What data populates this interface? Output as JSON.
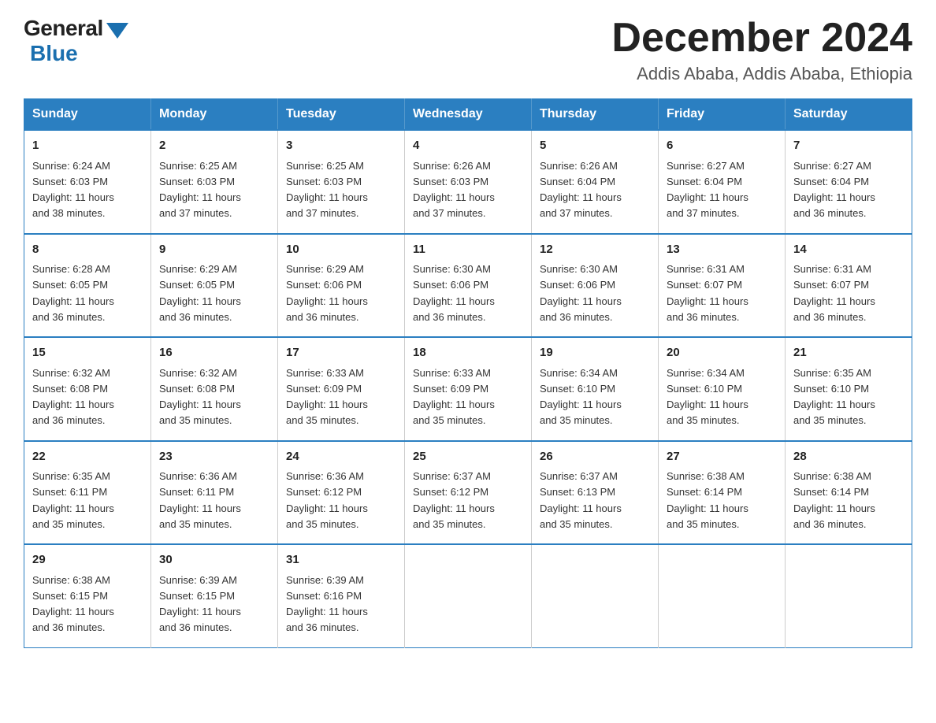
{
  "header": {
    "logo_general": "General",
    "logo_blue": "Blue",
    "month_title": "December 2024",
    "location": "Addis Ababa, Addis Ababa, Ethiopia"
  },
  "weekdays": [
    "Sunday",
    "Monday",
    "Tuesday",
    "Wednesday",
    "Thursday",
    "Friday",
    "Saturday"
  ],
  "weeks": [
    [
      {
        "day": "1",
        "sunrise": "6:24 AM",
        "sunset": "6:03 PM",
        "daylight": "11 hours and 38 minutes."
      },
      {
        "day": "2",
        "sunrise": "6:25 AM",
        "sunset": "6:03 PM",
        "daylight": "11 hours and 37 minutes."
      },
      {
        "day": "3",
        "sunrise": "6:25 AM",
        "sunset": "6:03 PM",
        "daylight": "11 hours and 37 minutes."
      },
      {
        "day": "4",
        "sunrise": "6:26 AM",
        "sunset": "6:03 PM",
        "daylight": "11 hours and 37 minutes."
      },
      {
        "day": "5",
        "sunrise": "6:26 AM",
        "sunset": "6:04 PM",
        "daylight": "11 hours and 37 minutes."
      },
      {
        "day": "6",
        "sunrise": "6:27 AM",
        "sunset": "6:04 PM",
        "daylight": "11 hours and 37 minutes."
      },
      {
        "day": "7",
        "sunrise": "6:27 AM",
        "sunset": "6:04 PM",
        "daylight": "11 hours and 36 minutes."
      }
    ],
    [
      {
        "day": "8",
        "sunrise": "6:28 AM",
        "sunset": "6:05 PM",
        "daylight": "11 hours and 36 minutes."
      },
      {
        "day": "9",
        "sunrise": "6:29 AM",
        "sunset": "6:05 PM",
        "daylight": "11 hours and 36 minutes."
      },
      {
        "day": "10",
        "sunrise": "6:29 AM",
        "sunset": "6:06 PM",
        "daylight": "11 hours and 36 minutes."
      },
      {
        "day": "11",
        "sunrise": "6:30 AM",
        "sunset": "6:06 PM",
        "daylight": "11 hours and 36 minutes."
      },
      {
        "day": "12",
        "sunrise": "6:30 AM",
        "sunset": "6:06 PM",
        "daylight": "11 hours and 36 minutes."
      },
      {
        "day": "13",
        "sunrise": "6:31 AM",
        "sunset": "6:07 PM",
        "daylight": "11 hours and 36 minutes."
      },
      {
        "day": "14",
        "sunrise": "6:31 AM",
        "sunset": "6:07 PM",
        "daylight": "11 hours and 36 minutes."
      }
    ],
    [
      {
        "day": "15",
        "sunrise": "6:32 AM",
        "sunset": "6:08 PM",
        "daylight": "11 hours and 36 minutes."
      },
      {
        "day": "16",
        "sunrise": "6:32 AM",
        "sunset": "6:08 PM",
        "daylight": "11 hours and 35 minutes."
      },
      {
        "day": "17",
        "sunrise": "6:33 AM",
        "sunset": "6:09 PM",
        "daylight": "11 hours and 35 minutes."
      },
      {
        "day": "18",
        "sunrise": "6:33 AM",
        "sunset": "6:09 PM",
        "daylight": "11 hours and 35 minutes."
      },
      {
        "day": "19",
        "sunrise": "6:34 AM",
        "sunset": "6:10 PM",
        "daylight": "11 hours and 35 minutes."
      },
      {
        "day": "20",
        "sunrise": "6:34 AM",
        "sunset": "6:10 PM",
        "daylight": "11 hours and 35 minutes."
      },
      {
        "day": "21",
        "sunrise": "6:35 AM",
        "sunset": "6:10 PM",
        "daylight": "11 hours and 35 minutes."
      }
    ],
    [
      {
        "day": "22",
        "sunrise": "6:35 AM",
        "sunset": "6:11 PM",
        "daylight": "11 hours and 35 minutes."
      },
      {
        "day": "23",
        "sunrise": "6:36 AM",
        "sunset": "6:11 PM",
        "daylight": "11 hours and 35 minutes."
      },
      {
        "day": "24",
        "sunrise": "6:36 AM",
        "sunset": "6:12 PM",
        "daylight": "11 hours and 35 minutes."
      },
      {
        "day": "25",
        "sunrise": "6:37 AM",
        "sunset": "6:12 PM",
        "daylight": "11 hours and 35 minutes."
      },
      {
        "day": "26",
        "sunrise": "6:37 AM",
        "sunset": "6:13 PM",
        "daylight": "11 hours and 35 minutes."
      },
      {
        "day": "27",
        "sunrise": "6:38 AM",
        "sunset": "6:14 PM",
        "daylight": "11 hours and 35 minutes."
      },
      {
        "day": "28",
        "sunrise": "6:38 AM",
        "sunset": "6:14 PM",
        "daylight": "11 hours and 36 minutes."
      }
    ],
    [
      {
        "day": "29",
        "sunrise": "6:38 AM",
        "sunset": "6:15 PM",
        "daylight": "11 hours and 36 minutes."
      },
      {
        "day": "30",
        "sunrise": "6:39 AM",
        "sunset": "6:15 PM",
        "daylight": "11 hours and 36 minutes."
      },
      {
        "day": "31",
        "sunrise": "6:39 AM",
        "sunset": "6:16 PM",
        "daylight": "11 hours and 36 minutes."
      },
      null,
      null,
      null,
      null
    ]
  ],
  "labels": {
    "sunrise": "Sunrise:",
    "sunset": "Sunset:",
    "daylight": "Daylight:"
  }
}
